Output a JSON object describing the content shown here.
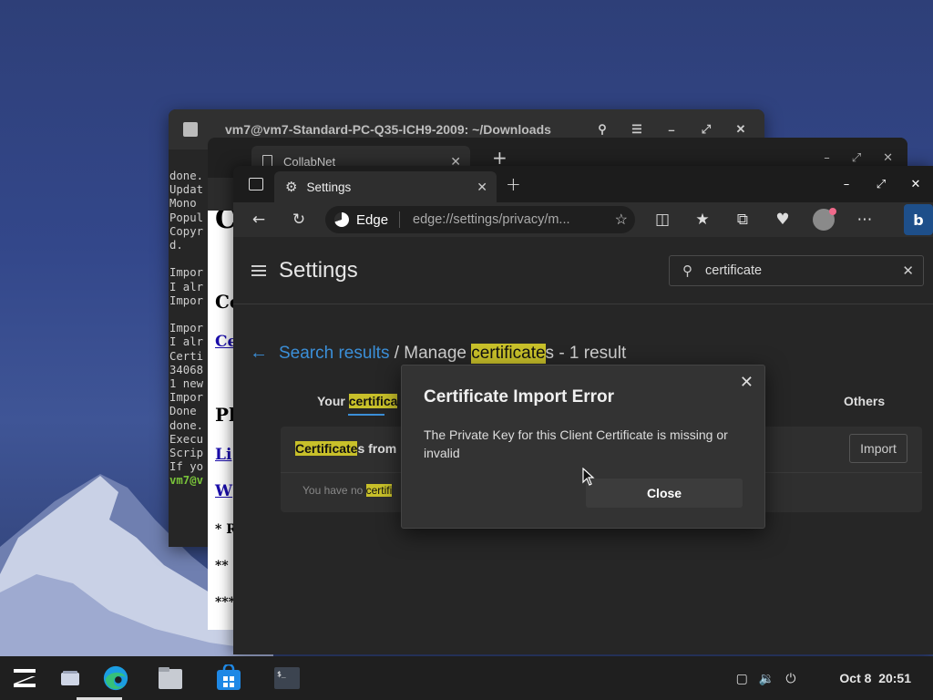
{
  "terminal": {
    "title": "vm7@vm7-Standard-PC-Q35-ICH9-2009: ~/Downloads",
    "lines": [
      {
        "text": "done."
      },
      {
        "text": "Updat"
      },
      {
        "text": "Mono"
      },
      {
        "text": "Popul"
      },
      {
        "text": "Copyr"
      },
      {
        "text": "d."
      },
      {
        "text": ""
      },
      {
        "text": "Impor"
      },
      {
        "text": "I alr"
      },
      {
        "text": "Impor"
      },
      {
        "text": ""
      },
      {
        "text": "Impor"
      },
      {
        "text": "I alr"
      },
      {
        "text": "Certi"
      },
      {
        "text": "34068"
      },
      {
        "text": "1 new"
      },
      {
        "text": "Impor"
      },
      {
        "text": "Done"
      },
      {
        "text": "done."
      },
      {
        "text": "Execu"
      },
      {
        "text": "Scrip"
      },
      {
        "text": "If yo"
      }
    ],
    "prompt": "vm7@v"
  },
  "collab": {
    "tab_title": "CollabNet",
    "page_fragments": [
      "C",
      "Co",
      "Ce",
      "Pl",
      "Li",
      "W",
      "* R",
      "**",
      "***"
    ]
  },
  "edge": {
    "tab_title": "Settings",
    "brand": "Edge",
    "url": "edge://settings/privacy/m...",
    "page_title": "Settings",
    "search_value": "certificate",
    "breadcrumb": {
      "link": "Search results",
      "separator": " / Manage ",
      "highlight": "certificate",
      "rest": "s - 1 result"
    },
    "tabs": {
      "yours_prefix": "Your ",
      "yours_highlight": "certifica",
      "others": "Others"
    },
    "card": {
      "row1_highlight": "Certificate",
      "row1_rest": "s from",
      "row2_prefix": "You have no ",
      "row2_highlight": "certifi",
      "import_label": "Import"
    }
  },
  "dialog": {
    "title": "Certificate Import Error",
    "message": "The Private Key for this Client Certificate is missing or invalid",
    "close_label": "Close"
  },
  "taskbar": {
    "date": "Oct 8",
    "time": "20:51"
  },
  "colors": {
    "highlight": "#c8c02a",
    "link": "#3b8fd8",
    "prompt_green": "#79c33a"
  }
}
